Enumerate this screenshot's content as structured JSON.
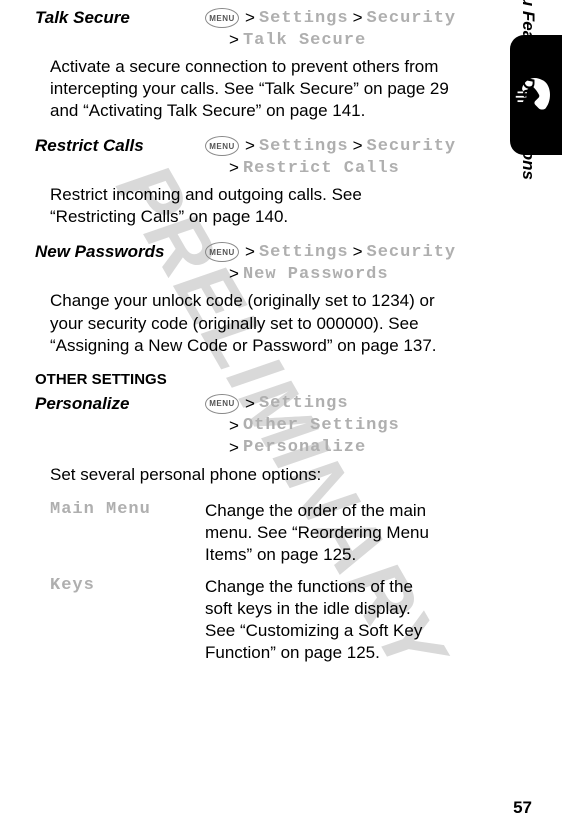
{
  "watermark": "PRELIMINARY",
  "sideLabel": "Menu Feature Descriptions",
  "pageNumber": "57",
  "menuButton": "MENU",
  "sep": ">",
  "sectionHeading": {
    "other": "O",
    "therRest": "THER",
    "s": " S",
    "ettingsRest": "ETTINGS"
  },
  "entries": {
    "talkSecure": {
      "title": "Talk Secure",
      "path": [
        "Settings",
        "Security",
        "Talk Secure"
      ],
      "body": "Activate a secure connection to prevent others from intercepting your calls. See “Talk Secure” on page 29 and “Activating Talk Secure” on page 141."
    },
    "restrictCalls": {
      "title": "Restrict Calls",
      "path": [
        "Settings",
        "Security",
        "Restrict Calls"
      ],
      "body": "Restrict incoming and outgoing calls. See “Restricting Calls” on page 140."
    },
    "newPasswords": {
      "title": "New Passwords",
      "path": [
        "Settings",
        "Security",
        "New Passwords"
      ],
      "body": "Change your unlock code (originally set to 1234) or your security code (originally set to 000000). See “Assigning a New Code or Password” on page 137."
    },
    "personalize": {
      "title": "Personalize",
      "path": [
        "Settings",
        "Other Settings",
        "Personalize"
      ],
      "lead": "Set several personal phone options:"
    }
  },
  "options": {
    "mainMenu": {
      "name": "Main Menu",
      "desc": "Change the order of the main menu. See “Reordering Menu Items” on page 125."
    },
    "keys": {
      "name": "Keys",
      "desc": "Change the functions of the soft keys in the idle display. See “Customizing a Soft Key Function” on page 125."
    }
  }
}
